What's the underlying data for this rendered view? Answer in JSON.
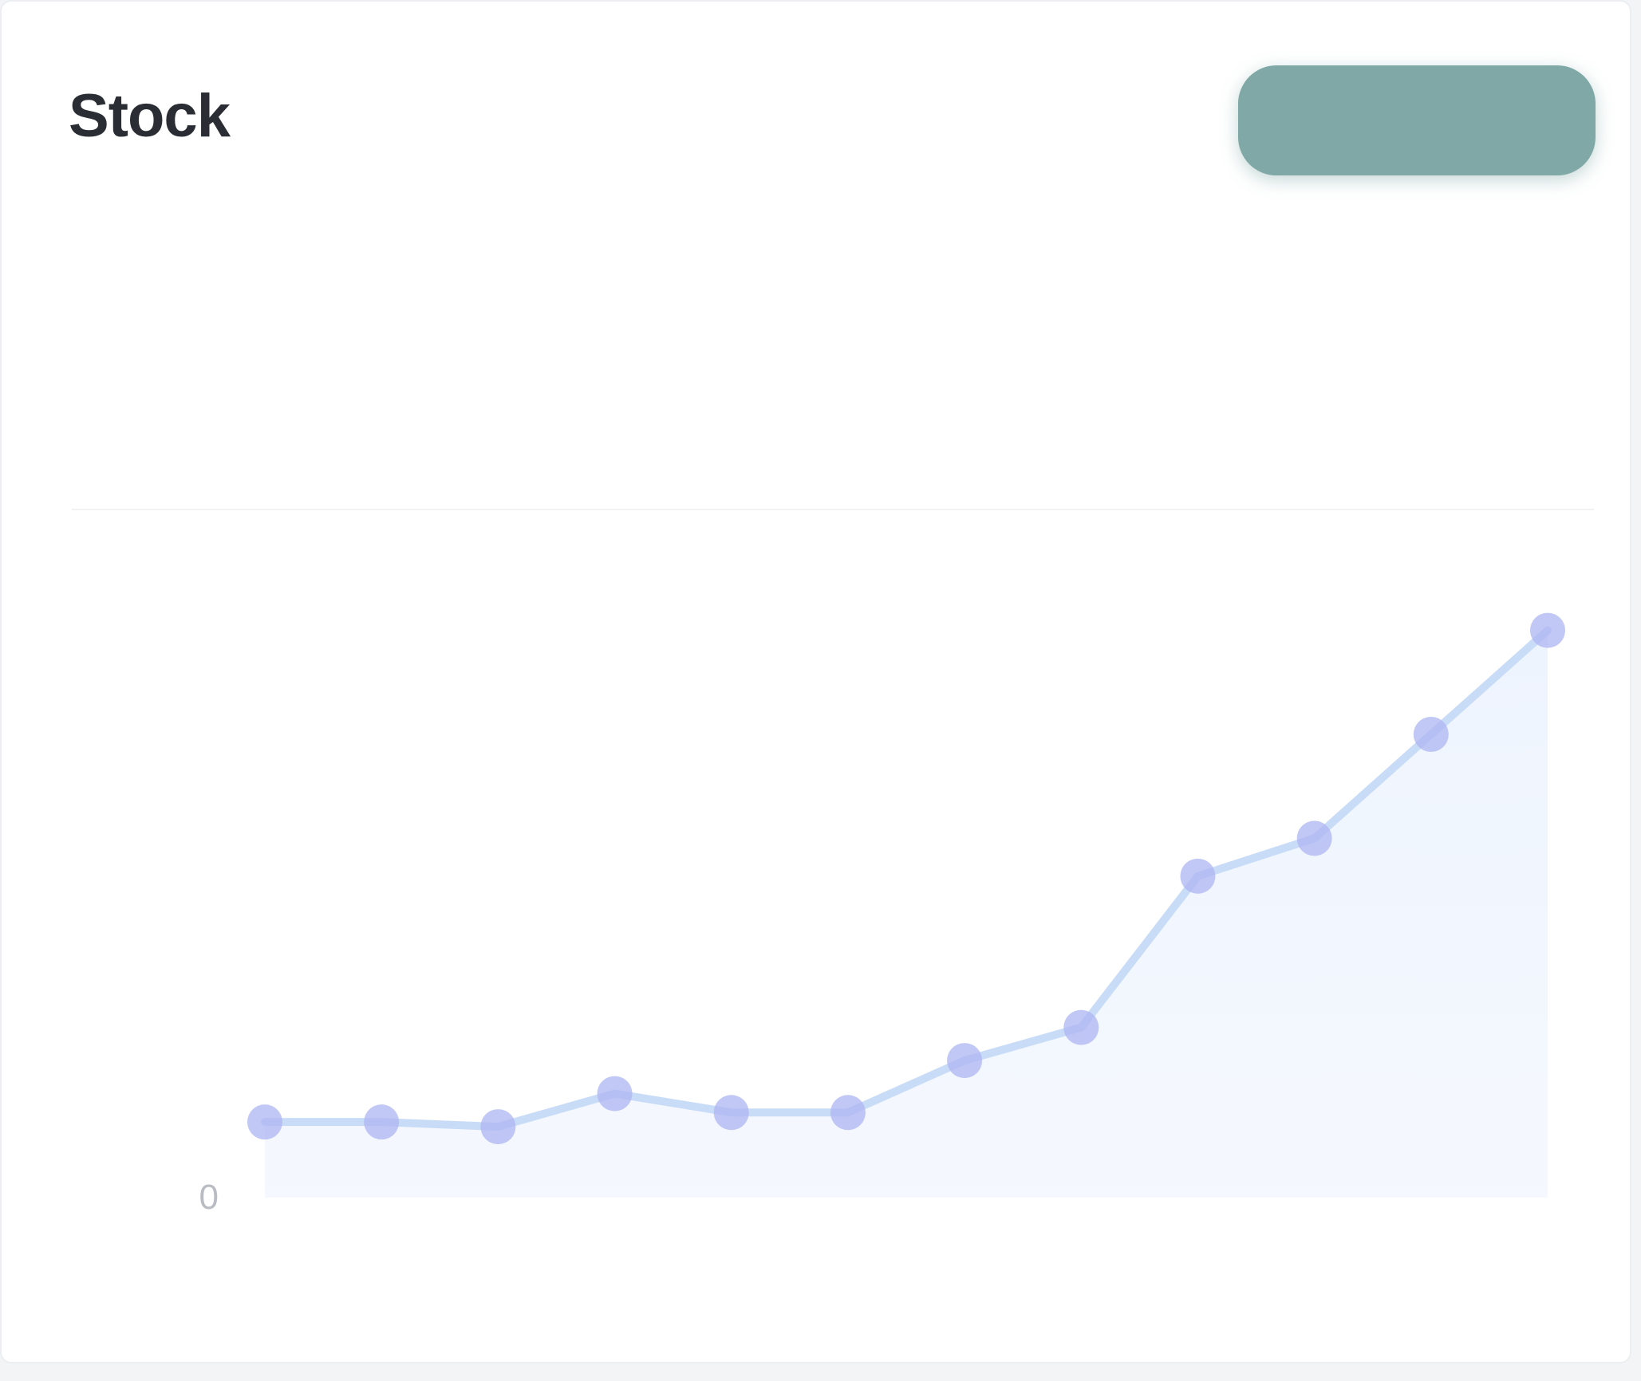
{
  "header": {
    "title": "Stock",
    "title_suffix": "",
    "link_label": ""
  },
  "action_button": {
    "label": ""
  },
  "stats": [
    {
      "label": "",
      "value": ""
    },
    {
      "label": "",
      "value": ""
    }
  ],
  "colors": {
    "accent": "#6c79db",
    "line": "#c9dcf7",
    "area": "#eef4fe",
    "marker": "#aeb6f2",
    "button": "#7fa8a6"
  },
  "chart_data": {
    "type": "area",
    "x": [
      "",
      "",
      "",
      "",
      "",
      "",
      "",
      "",
      "",
      "",
      "",
      "",
      ""
    ],
    "x_tick_labels": [
      "",
      ""
    ],
    "series": [
      {
        "values": [
          8,
          8,
          7.5,
          11,
          9,
          9,
          14.5,
          18,
          34,
          38,
          49,
          60
        ]
      }
    ],
    "ylim": [
      0,
      70
    ],
    "y_ticks": [
      0,
      10,
      20,
      30,
      40,
      50,
      60,
      70
    ],
    "y_tick_labels": [
      "0",
      "",
      "",
      "",
      "",
      "",
      "",
      ""
    ],
    "grid": false,
    "legend": "none"
  }
}
